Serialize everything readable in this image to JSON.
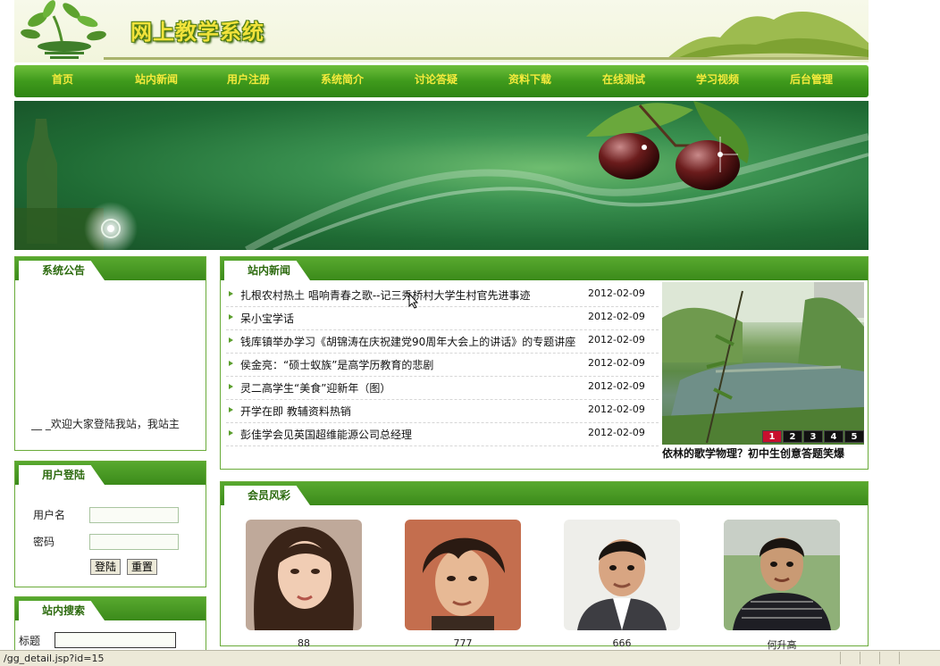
{
  "site": {
    "title": "网上教学系统"
  },
  "nav": {
    "items": [
      "首页",
      "站内新闻",
      "用户注册",
      "系统简介",
      "讨论答疑",
      "资料下载",
      "在线测试",
      "学习视频",
      "后台管理"
    ]
  },
  "notice": {
    "heading": "系统公告",
    "text": "__ _欢迎大家登陆我站，我站主"
  },
  "login": {
    "heading": "用户登陆",
    "username_label": "用户名",
    "password_label": "密码",
    "username_value": "",
    "password_value": "",
    "login_button": "登陆",
    "reset_button": "重置"
  },
  "search": {
    "heading": "站内搜索",
    "title_label": "标题",
    "title_value": ""
  },
  "news": {
    "heading": "站内新闻",
    "items": [
      {
        "title": "扎根农村热土 唱响青春之歌--记三秀桥村大学生村官先进事迹",
        "date": "2012-02-09"
      },
      {
        "title": "呆小宝学话",
        "date": "2012-02-09"
      },
      {
        "title": "钱库镇举办学习《胡锦涛在庆祝建党90周年大会上的讲话》的专题讲座",
        "date": "2012-02-09"
      },
      {
        "title": "侯金亮：“硕士蚁族”是高学历教育的悲剧",
        "date": "2012-02-09"
      },
      {
        "title": "灵二高学生“美食”迎新年（图）",
        "date": "2012-02-09"
      },
      {
        "title": "开学在即 教辅资料热销",
        "date": "2012-02-09"
      },
      {
        "title": "彭佳学会见英国超维能源公司总经理",
        "date": "2012-02-09"
      }
    ],
    "slide_numbers": [
      "1",
      "2",
      "3",
      "4",
      "5"
    ],
    "slide_caption": "依林的歌学物理？初中生创意答题笑爆"
  },
  "members": {
    "heading": "会员风彩",
    "items": [
      {
        "name": "88"
      },
      {
        "name": "777"
      },
      {
        "name": "666"
      },
      {
        "name": "何升高"
      }
    ]
  },
  "statusbar": {
    "text": "/gg_detail.jsp?id=15"
  },
  "colors": {
    "nav_text": "#f4ea3c",
    "brand_green": "#3b8a1a",
    "accent_red": "#c8102e"
  }
}
